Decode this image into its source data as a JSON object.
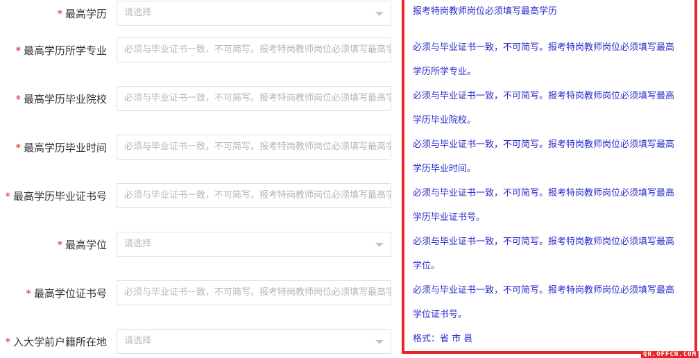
{
  "form": {
    "fields": [
      {
        "label": "最高学历",
        "placeholder": "请选择",
        "type": "select"
      },
      {
        "label": "最高学历所学专业",
        "placeholder": "必须与毕业证书一致，不可简写。报考特岗教师岗位必须填写最高学历所学专业",
        "type": "input"
      },
      {
        "label": "最高学历毕业院校",
        "placeholder": "必须与毕业证书一致，不可简写。报考特岗教师岗位必须填写最高学历毕业院校",
        "type": "input"
      },
      {
        "label": "最高学历毕业时间",
        "placeholder": "必须与毕业证书一致，不可简写。报考特岗教师岗位必须填写最高学历毕业时间",
        "type": "input"
      },
      {
        "label": "最高学历毕业证书号",
        "placeholder": "必须与毕业证书一致，不可简写。报考特岗教师岗位必须填写最高学历毕业证书号",
        "type": "input"
      },
      {
        "label": "最高学位",
        "placeholder": "请选择",
        "type": "select"
      },
      {
        "label": "最高学位证书号",
        "placeholder": "必须与毕业证书一致，不可简写。报考特岗教师岗位必须填写最高学位证书号",
        "type": "input"
      },
      {
        "label": "入大学前户籍所在地",
        "placeholder": "请选择",
        "type": "select"
      }
    ]
  },
  "hints": {
    "lines": [
      "报考特岗教师岗位必须填写最高学历",
      "必须与毕业证书一致，不可简写。报考特岗教师岗位必须填写最高",
      "学历所学专业。",
      "必须与毕业证书一致，不可简写。报考特岗教师岗位必须填写最高",
      "学历毕业院校。",
      "必须与毕业证书一致，不可简写。报考特岗教师岗位必须填写最高",
      "学历毕业时间。",
      "必须与毕业证书一致，不可简写。报考特岗教师岗位必须填写最高",
      "学历毕业证书号。",
      "必须与毕业证书一致，不可简写。报考特岗教师岗位必须填写最高",
      "学位。",
      "必须与毕业证书一致，不可简写。报考特岗教师岗位必须填写最高",
      "学位证书号。",
      "格式：省 市 县"
    ],
    "border_color": "#e8262c",
    "text_color": "#2929cc"
  },
  "required_marker": "*",
  "watermark": "QH.OFFCN.COM"
}
